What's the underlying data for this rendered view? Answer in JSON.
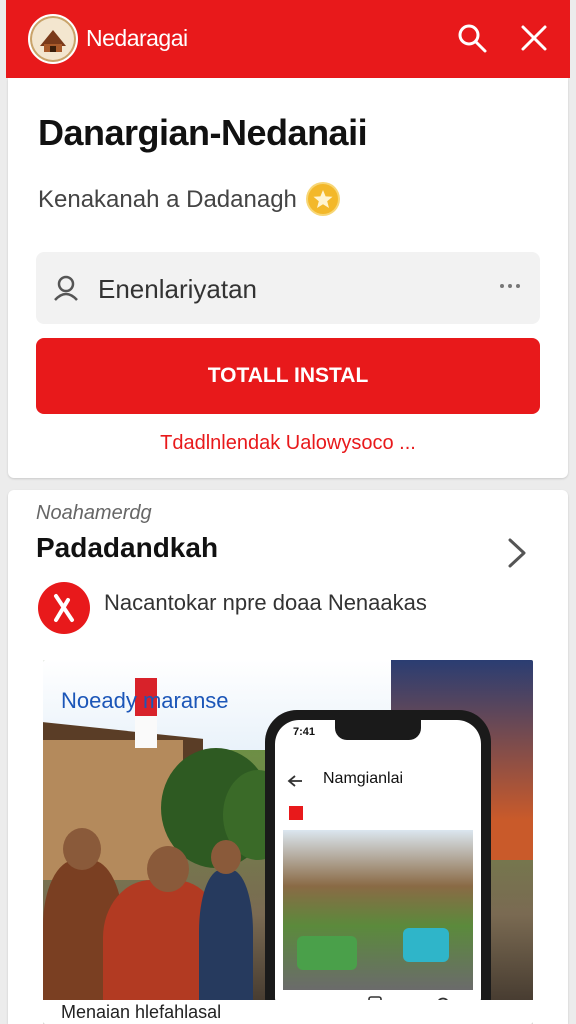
{
  "header": {
    "app_name": "Nedaragai"
  },
  "card": {
    "title": "Danargian-Nedanaii",
    "subtitle": "Kenakanah a Dadanagh",
    "search_value": "Enenlariyatan",
    "install_label": "TOTALL INSTAL",
    "link_text": "Tdadlnlendak Ualowysoco ..."
  },
  "section": {
    "overline": "Noahamerdg",
    "title": "Padadandkah",
    "row_text": "Nacantokar npre doaa Nenaakas"
  },
  "hero": {
    "caption": "Noeady maranse",
    "footer_text": "Menaian hlefahlasal"
  },
  "phone": {
    "time": "7:41",
    "title": "Namgianlai"
  },
  "colors": {
    "brand_red": "#e8191b"
  },
  "icons": [
    "search-icon",
    "close-icon",
    "user-icon",
    "more-icon",
    "chevron-right-icon",
    "star-badge-icon",
    "back-arrow-icon"
  ]
}
